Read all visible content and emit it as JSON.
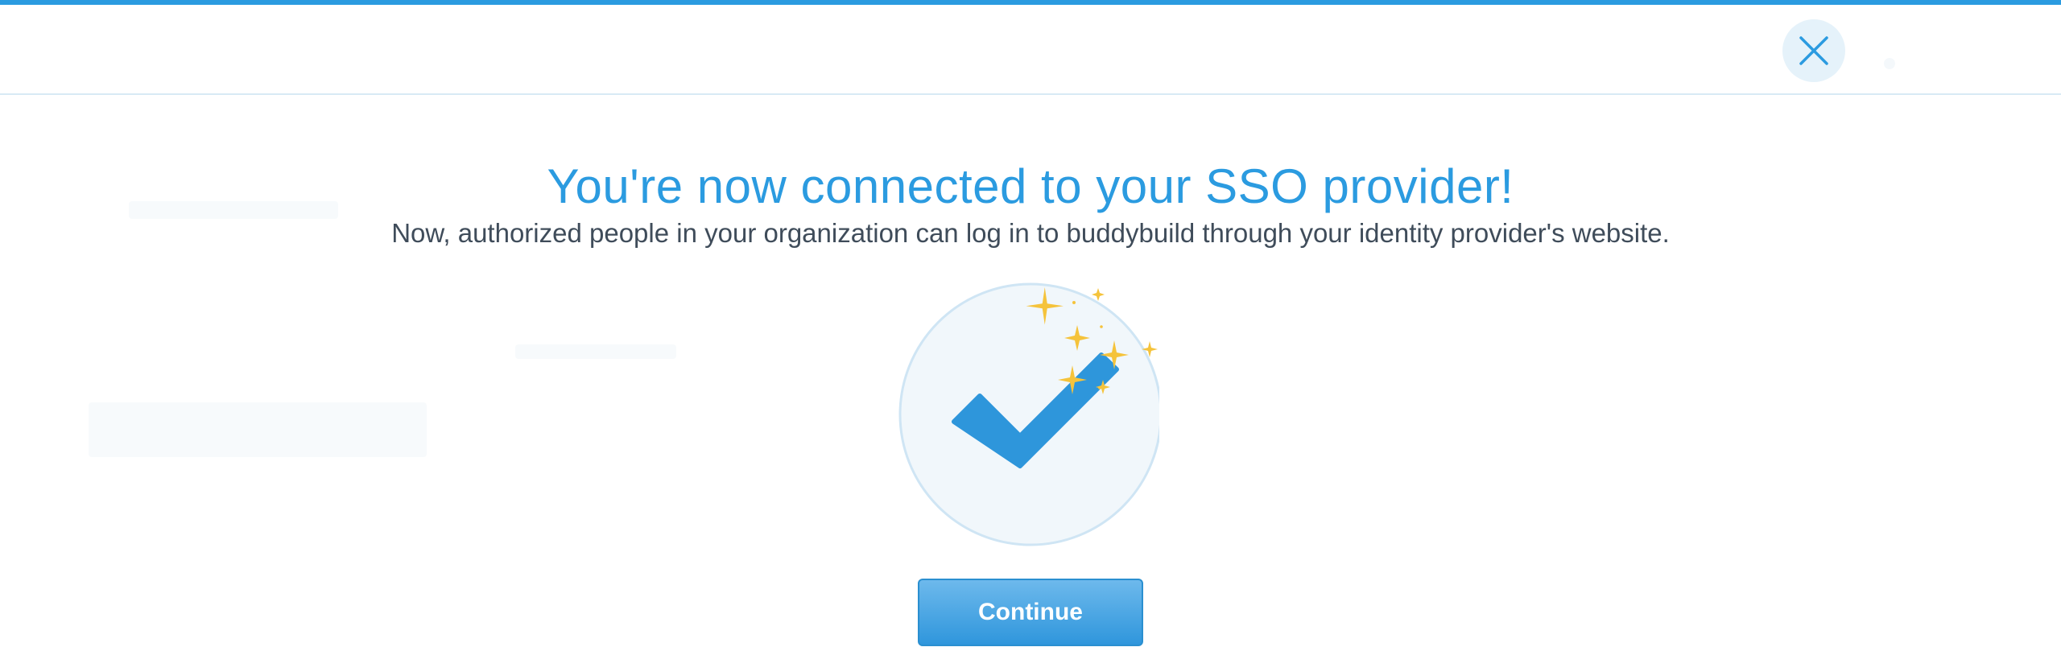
{
  "header": {
    "close_icon": "close-icon"
  },
  "main": {
    "title": "You're now connected to your SSO provider!",
    "subtitle": "Now, authorized people in your organization can log in to buddybuild through your identity provider's website.",
    "illustration_icon": "checkmark-sparkles-icon",
    "continue_label": "Continue"
  },
  "colors": {
    "accent": "#2b9be0",
    "sparkle": "#f5c33b",
    "text": "#3f4c5a",
    "badge_bg": "#f1f7fb"
  }
}
